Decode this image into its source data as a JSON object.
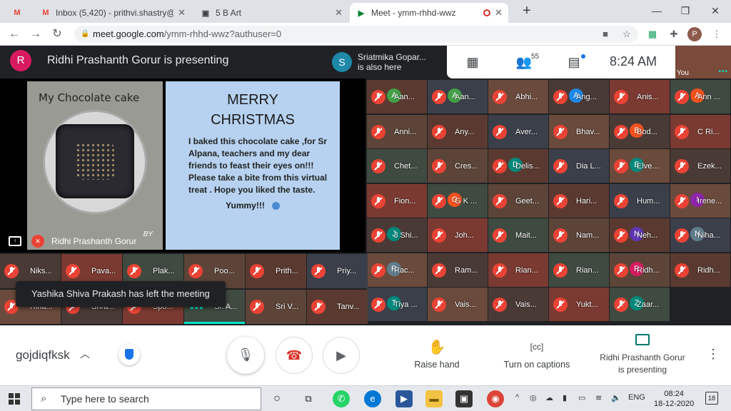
{
  "browser": {
    "tabs": [
      {
        "label": "",
        "favicon": "gmail-icon"
      },
      {
        "label": "Inbox (5,420) - prithvi.shastry@sc",
        "favicon": "gmail-icon"
      },
      {
        "label": "5 B Art",
        "favicon": "classroom-icon"
      },
      {
        "label": "Meet - ymm-rhhd-wwz",
        "favicon": "meet-icon",
        "active": true
      }
    ],
    "new_tab": "+",
    "url_host": "meet.google.com",
    "url_path": "/ymm-rhhd-wwz?authuser=0",
    "profile_initial": "P"
  },
  "meet": {
    "presenter_initial": "R",
    "presenter_banner": "Ridhi Prashanth Gorur is presenting",
    "join_notice": {
      "initial": "S",
      "name": "Sriatmika Gopar...",
      "status": "is also here"
    },
    "participant_count": "55",
    "time": "8:24 AM",
    "self_label": "You",
    "slide_cake_title": "My Chocolate cake",
    "slide_cake_sign": "BY",
    "slide_title_line1": "MERRY",
    "slide_title_line2": "CHRISTMAS",
    "slide_body": "I baked this chocolate cake ,for Sr Alpana, teachers and my dear friends to feast their eyes on!!! Please take a bite from this virtual treat . Hope you liked the taste.",
    "slide_yummy": "Yummy!!!",
    "presentation_footer": "Ridhi Prashanth Gorur",
    "toast": "Yashika Shiva Prakash has left the meeting",
    "grid": [
      [
        "Aan...",
        "Aan...",
        "Abhi...",
        "Ang...",
        "Anis...",
        "Ann ..."
      ],
      [
        "Anni...",
        "Any...",
        "Aver...",
        "Bhav...",
        "Bod...",
        "C Ri..."
      ],
      [
        "Chet...",
        "Cres...",
        "Delis...",
        "Dia L...",
        "Elve...",
        "Ezek..."
      ],
      [
        "Fion...",
        "G K ...",
        "Geet...",
        "Hari...",
        "Hum...",
        "Irene..."
      ],
      [
        "J Shi...",
        "Joh...",
        "Mait...",
        "Nam...",
        "Neh...",
        "Niha..."
      ],
      [
        "Rac...",
        "Ram...",
        "Rian...",
        "Rian...",
        "Ridh...",
        "Ridh..."
      ],
      [
        "Tiya ...",
        "Vais...",
        "Vais...",
        "Yukt...",
        "Zaar...",
        ""
      ]
    ],
    "grid_avatars": [
      [
        {
          "i": "A",
          "c": "#43a047"
        },
        {
          "i": "A",
          "c": "#43a047"
        },
        null,
        {
          "i": "A",
          "c": "#1e88e5"
        },
        null,
        {
          "i": "A",
          "c": "#f4511e"
        }
      ],
      [
        null,
        null,
        null,
        null,
        {
          "i": "B",
          "c": "#f4511e"
        },
        null
      ],
      [
        null,
        null,
        {
          "i": "D",
          "c": "#00897b"
        },
        null,
        {
          "i": "E",
          "c": "#00897b"
        },
        null
      ],
      [
        null,
        {
          "i": "G",
          "c": "#f4511e"
        },
        null,
        null,
        null,
        {
          "i": "I",
          "c": "#8e24aa"
        }
      ],
      [
        {
          "i": "J",
          "c": "#00897b"
        },
        null,
        null,
        null,
        {
          "i": "N",
          "c": "#5e35b1"
        },
        {
          "i": "N",
          "c": "#607d8b"
        }
      ],
      [
        {
          "i": "R",
          "c": "#607d8b"
        },
        null,
        null,
        null,
        {
          "i": "R",
          "c": "#d81b60"
        },
        null
      ],
      [
        {
          "i": "T",
          "c": "#00897b"
        },
        null,
        null,
        null,
        {
          "i": "Z",
          "c": "#00897b"
        },
        null
      ]
    ],
    "bottom_row_top": [
      "Niks...",
      "Pava...",
      "Plak...",
      "Poo...",
      "Prith...",
      "Priy..."
    ],
    "bottom_row_bottom": [
      "Riha...",
      "Shra...",
      "Spo...",
      "Sr. A...",
      "Sri V...",
      "Tanv..."
    ]
  },
  "controls": {
    "meeting_code": "gojdiqfksk",
    "raise_hand": "Raise hand",
    "captions": "Turn on captions",
    "presenting_line1": "Ridhi Prashanth Gorur",
    "presenting_line2": "is presenting"
  },
  "taskbar": {
    "search_placeholder": "Type here to search",
    "lang": "ENG",
    "time": "08:24",
    "date": "18-12-2020",
    "notif_count": "18"
  },
  "colors": {
    "meet_bg": "#202124",
    "mic_off": "#ea4335",
    "accent_teal": "#00e5c4",
    "hangup": "#d93025"
  }
}
